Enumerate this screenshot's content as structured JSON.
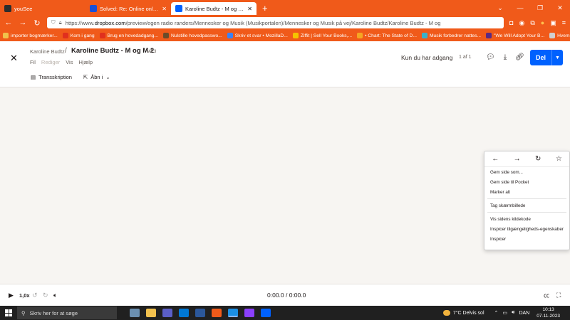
{
  "browser": {
    "tabs": [
      {
        "title": "youSee",
        "color": "#2d2d2d",
        "active": false
      },
      {
        "title": "Solved: Re: Online only - where",
        "color": "#1a4fd6",
        "active": false
      },
      {
        "title": "Karoline Budtz - M og M 2.mp3",
        "color": "#0061fe",
        "active": true
      }
    ],
    "new_tab": "+",
    "url_prefix": "https://www.",
    "url_domain": "dropbox.com",
    "url_path": "/preview/egen radio randers/Mennesker og Musik (Musikportalen)/Mennesker og Musik på vej/Karoline Budtz/Karoline Budtz - M og",
    "bookmarks": [
      {
        "label": "importer bogmærker...",
        "color": "#f0c14b"
      },
      {
        "label": "Kom i gang",
        "color": "#e0301e"
      },
      {
        "label": "Brug en hovedadgang...",
        "color": "#e0301e"
      },
      {
        "label": "Nulstille hovedpasswo...",
        "color": "#6a4c2a"
      },
      {
        "label": "Skriv et svar • MozillaD...",
        "color": "#3b82f6"
      },
      {
        "label": "Ziffit | Sell Your Books,...",
        "color": "#f5c400"
      },
      {
        "label": "• Chart: The State of D...",
        "color": "#f5a623"
      },
      {
        "label": "Musik forbedrer nattes...",
        "color": "#3ab0c9"
      },
      {
        "label": "\"We Will Adopt Your B...",
        "color": "#5a2a82"
      },
      {
        "label": "Hvem spiser stikkelsb...",
        "color": "#d0d0d0"
      }
    ]
  },
  "header": {
    "owner": "Karoline Budtz",
    "separator": "/",
    "filename": "Karoline Budtz - M og M 2",
    "extension": "MP3",
    "menu": [
      "Fil",
      "Rediger",
      "Vis",
      "Hjælp"
    ],
    "transcription": "Transskription",
    "open_in": "Åbn i",
    "access": "Kun du har adgang",
    "page_count": "1 af 1",
    "share": "Del"
  },
  "player": {
    "speed": "1,0x",
    "time": "0:00.0 / 0:00.0"
  },
  "context_menu": {
    "items": [
      [
        "Gem side som...",
        "Gem side til Pocket",
        "Marker alt"
      ],
      [
        "Tag skærmbillede"
      ],
      [
        "Vis sidens kildekode",
        "Inspicer tilgængeligheds-egenskaber",
        "Inspicer"
      ]
    ]
  },
  "taskbar": {
    "search_placeholder": "Skriv her for at søge",
    "apps": [
      "#6b8fb0",
      "#f2c14e",
      "#5b5fc7",
      "#0078d4",
      "#2b579a",
      "#f05a1a",
      "#1b8fe3",
      "#8a3ffc",
      "#0061fe"
    ],
    "weather": "7°C  Delvis sol",
    "lang": "DAN",
    "time": "10:13",
    "date": "07-11-2023"
  },
  "accent": "#0061fe",
  "browser_color": "#f05a1a"
}
